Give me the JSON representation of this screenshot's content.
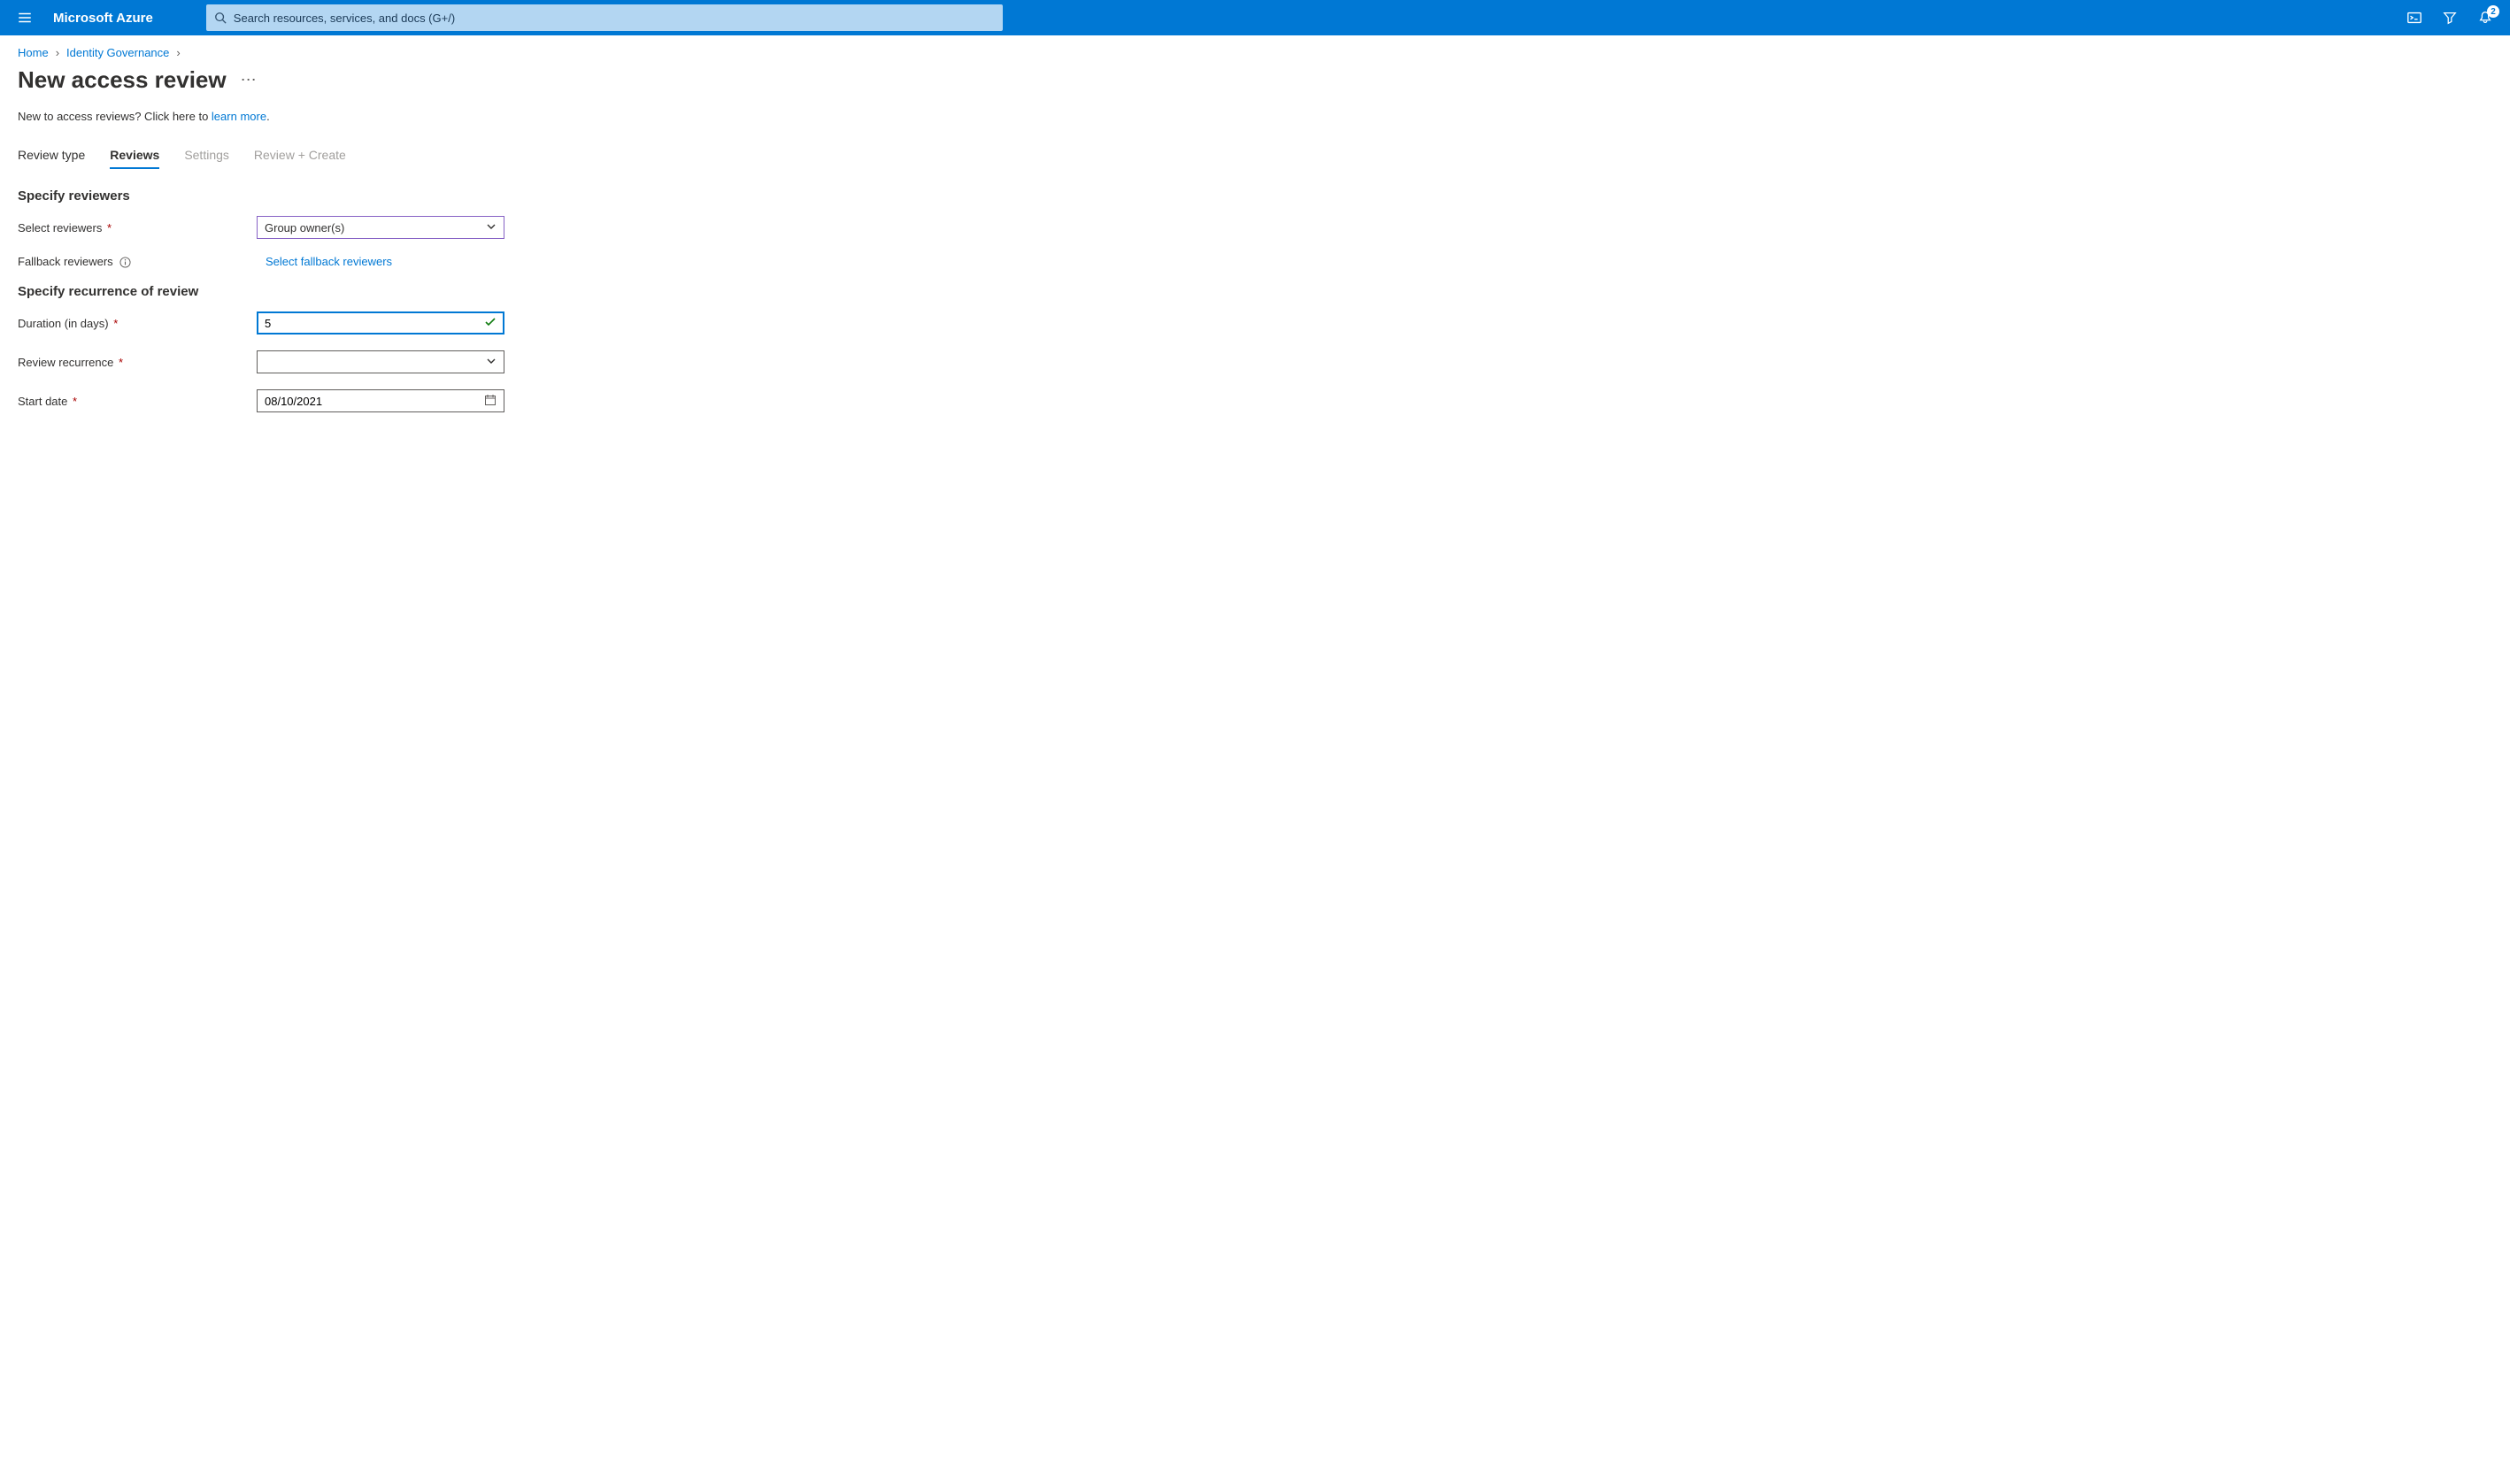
{
  "header": {
    "brand": "Microsoft Azure",
    "search_placeholder": "Search resources, services, and docs (G+/)",
    "notification_count": "2"
  },
  "breadcrumb": {
    "items": [
      "Home",
      "Identity Governance"
    ]
  },
  "page": {
    "title": "New access review",
    "intro_prefix": "New to access reviews? Click here to ",
    "intro_link": "learn more",
    "intro_suffix": "."
  },
  "tabs": [
    {
      "label": "Review type",
      "state": "normal"
    },
    {
      "label": "Reviews",
      "state": "active"
    },
    {
      "label": "Settings",
      "state": "disabled"
    },
    {
      "label": "Review + Create",
      "state": "disabled"
    }
  ],
  "section_reviewers": {
    "heading": "Specify reviewers",
    "select_reviewers_label": "Select reviewers",
    "select_reviewers_value": "Group owner(s)",
    "fallback_label": "Fallback reviewers",
    "fallback_link": "Select fallback reviewers"
  },
  "section_recurrence": {
    "heading": "Specify recurrence of review",
    "duration_label": "Duration (in days)",
    "duration_value": "5",
    "recurrence_label": "Review recurrence",
    "recurrence_value": "",
    "start_label": "Start date",
    "start_value": "08/10/2021"
  }
}
